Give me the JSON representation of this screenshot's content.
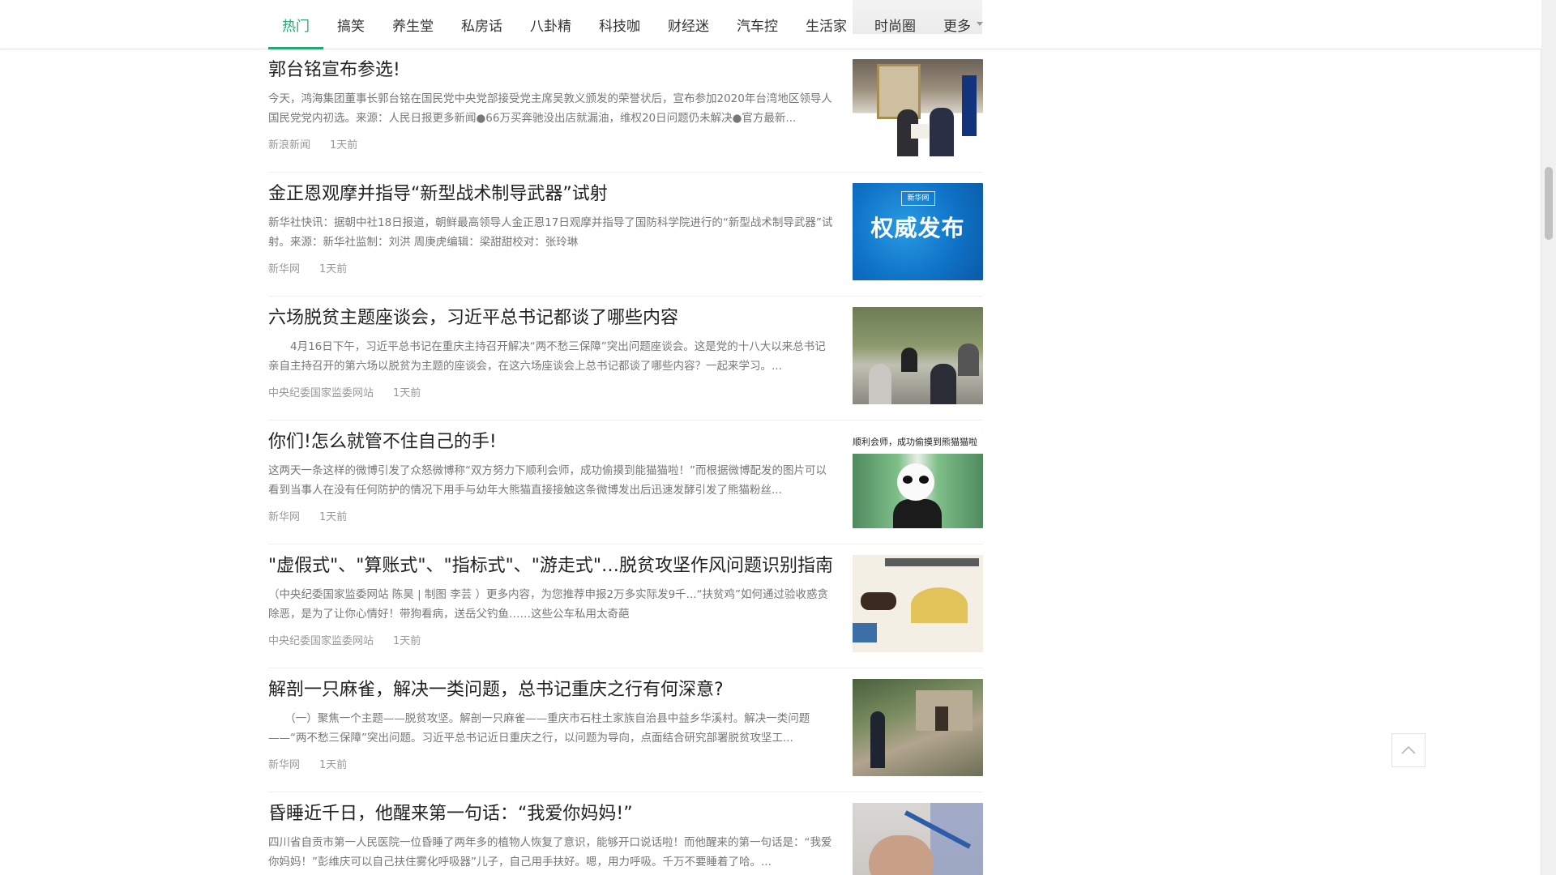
{
  "nav": {
    "tabs": [
      {
        "label": "热门",
        "active": true
      },
      {
        "label": "搞笑"
      },
      {
        "label": "养生堂"
      },
      {
        "label": "私房话"
      },
      {
        "label": "八卦精"
      },
      {
        "label": "科技咖"
      },
      {
        "label": "财经迷"
      },
      {
        "label": "汽车控"
      },
      {
        "label": "生活家"
      },
      {
        "label": "时尚圈"
      },
      {
        "label": "更多",
        "has_dropdown": true
      }
    ],
    "accent_color": "#23a86e"
  },
  "feed": {
    "items": [
      {
        "title": "郭台铭宣布参选!",
        "summary": "今天，鸿海集团董事长郭台铭在国民党中央党部接受党主席吴敦义颁发的荣誉状后，宣布参加2020年台湾地区领导人国民党党内初选。来源：人民日报更多新闻●66万买奔驰没出店就漏油，维权20日问题仍未解决●官方最新...",
        "source": "新浪新闻",
        "time": "1天前",
        "thumb_icon": "news-photo"
      },
      {
        "title": "金正恩观摩并指导“新型战术制导武器”试射",
        "summary": "新华社快讯：据朝中社18日报道，朝鲜最高领导人金正恩17日观摩并指导了国防科学院进行的“新型战术制导武器”试射。来源：新华社监制：刘洪 周庚虎编辑：梁甜甜校对：张玲琳",
        "source": "新华网",
        "time": "1天前",
        "thumb_text": "权威发布",
        "thumb_logo_text": "新华网"
      },
      {
        "title": "六场脱贫主题座谈会，习近平总书记都谈了哪些内容",
        "summary": "　　4月16日下午，习近平总书记在重庆主持召开解决“两不愁三保障”突出问题座谈会。这是党的十八大以来总书记亲自主持召开的第六场以脱贫为主题的座谈会，在这六场座谈会上总书记都谈了哪些内容？一起来学习。...",
        "source": "中央纪委国家监委网站",
        "time": "1天前",
        "thumb_icon": "news-photo"
      },
      {
        "title": "你们!怎么就管不住自己的手!",
        "summary": "这两天一条这样的微博引发了众怒微博称“双方努力下顺利会师，成功偷摸到能猫猫啦！”而根据微博配发的图片可以看到当事人在没有任何防护的情况下用手与幼年大熊猫直接接触这条微博发出后迅速发酵引发了熊猫粉丝...",
        "source": "新华网",
        "time": "1天前",
        "thumb_caption": "顺利会师，成功偷摸到熊猫猫啦"
      },
      {
        "title": "\"虚假式\"、\"算账式\"、\"指标式\"、\"游走式\"…脱贫攻坚作风问题识别指南",
        "summary": "（中央纪委国家监委网站 陈昊 | 制图 李芸 ）更多内容，为您推荐申报2万多实际发9千...“扶贫鸡”如何通过验收惑贪除恶，是为了让你心情好！带狗看病，送岳父钓鱼……这些公车私用太奇葩",
        "source": "中央纪委国家监委网站",
        "time": "1天前",
        "thumb_icon": "illustration"
      },
      {
        "title": "解剖一只麻雀，解决一类问题，总书记重庆之行有何深意?",
        "summary": "　　（一）聚焦一个主题——脱贫攻坚。解剖一只麻雀——重庆市石柱土家族自治县中益乡华溪村。解决一类问题——“两不愁三保障”突出问题。习近平总书记近日重庆之行，以问题为导向，点面结合研究部署脱贫攻坚工...",
        "source": "新华网",
        "time": "1天前",
        "thumb_icon": "news-photo"
      },
      {
        "title": "昏睡近千日，他醒来第一句话：“我爱你妈妈!”",
        "summary": "四川省自贡市第一人民医院一位昏睡了两年多的植物人恢复了意识，能够开口说话啦！而他醒来的第一句话是：“我爱你妈妈！”彭维庆可以自己扶住雾化呼吸器”儿子，自己用手扶好。嗯，用力呼吸。千万不要睡着了哈。...",
        "source": "",
        "time": "",
        "thumb_icon": "news-photo"
      }
    ]
  },
  "controls": {
    "back_to_top_icon": "chevron-up-icon"
  }
}
